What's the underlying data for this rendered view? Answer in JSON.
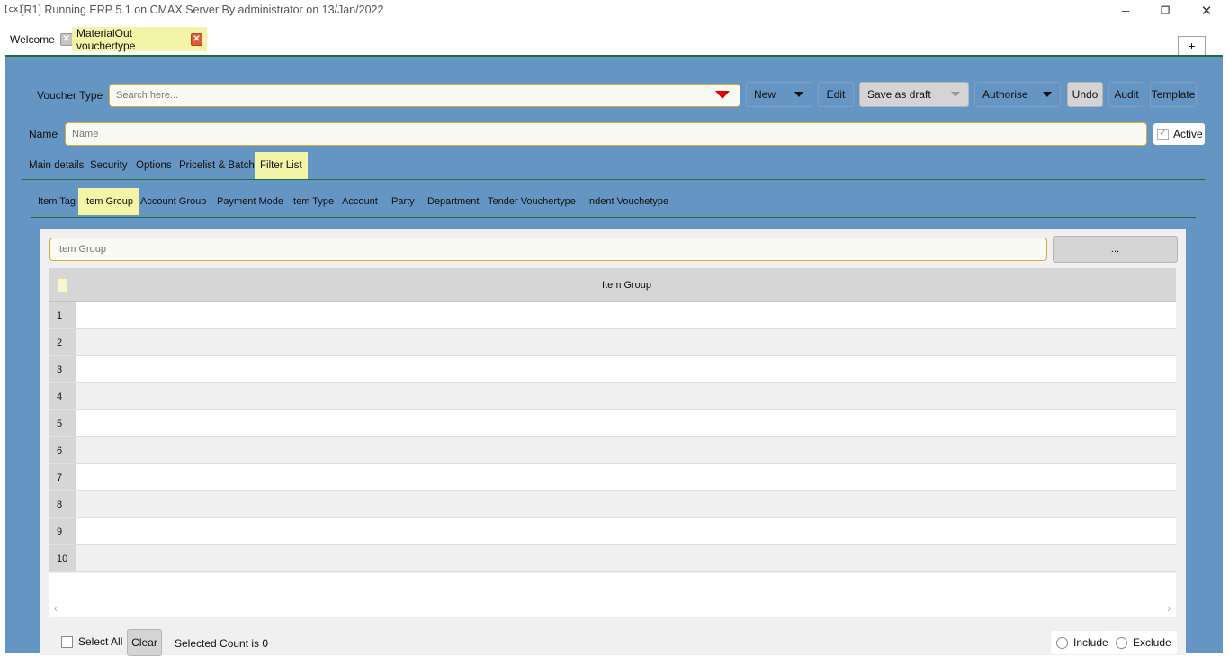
{
  "window": {
    "app_icon": "[cx]",
    "title": "[R1] Running ERP 5.1 on CMAX Server By administrator on 13/Jan/2022",
    "minimize": "─",
    "restore": "❐",
    "close": "✕"
  },
  "doc_tabs": [
    {
      "label": "Welcome",
      "close": "✕"
    },
    {
      "label": "MaterialOut vouchertype",
      "close": "✕"
    }
  ],
  "plus_label": "+",
  "toolbar": {
    "voucher_type_label": "Voucher Type",
    "search_placeholder": "Search here...",
    "new_label": "New",
    "edit_label": "Edit",
    "save_draft_label": "Save as draft",
    "authorise_label": "Authorise",
    "undo_label": "Undo",
    "audit_label": "Audit",
    "template_label": "Template"
  },
  "name_row": {
    "label": "Name",
    "placeholder": "Name",
    "active_label": "Active",
    "active_checked": true
  },
  "main_tabs": [
    "Main details",
    "Security",
    "Options",
    "Pricelist & Batch",
    "Filter List"
  ],
  "filter_tabs": [
    "Item Tag",
    "Item Group",
    "Account Group",
    "Payment Mode",
    "Item Type",
    "Account",
    "Party",
    "Department",
    "Tender Vouchertype",
    "Indent Vouchetype"
  ],
  "panel": {
    "item_group_placeholder": "Item Group",
    "browse_label": "...",
    "column_header": "Item Group",
    "rows": [
      "1",
      "2",
      "3",
      "4",
      "5",
      "6",
      "7",
      "8",
      "9",
      "10"
    ],
    "scroll_left": "‹",
    "scroll_right": "›"
  },
  "footer": {
    "select_all_label": "Select All",
    "clear_label": "Clear",
    "selected_count": "Selected Count is 0",
    "include_label": "Include",
    "exclude_label": "Exclude"
  },
  "colors": {
    "main_bg": "#6595c3",
    "active_tab": "#f4f4a8",
    "accent_line": "#1f6e36",
    "close_red": "#e05a3a"
  }
}
